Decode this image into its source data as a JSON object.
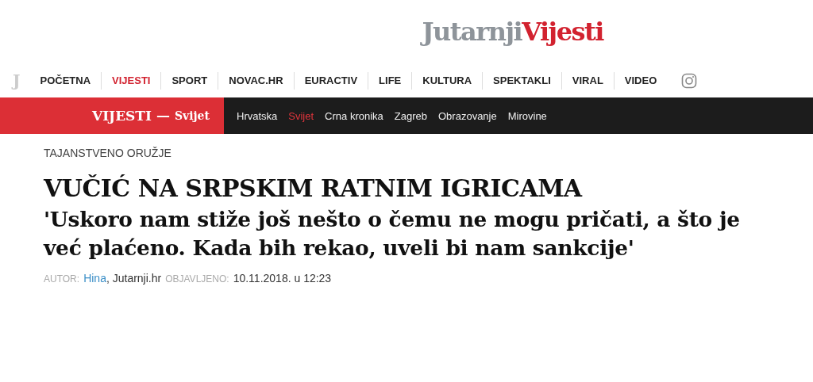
{
  "logo": {
    "part_1": "Jutarnji",
    "part_2": "Vijesti"
  },
  "nav": {
    "mark": "J",
    "items": [
      {
        "label": "POČETNA",
        "selected": false
      },
      {
        "label": "VIJESTI",
        "selected": true
      },
      {
        "label": "SPORT",
        "selected": false
      },
      {
        "label": "NOVAC.HR",
        "selected": false
      },
      {
        "label": "EURACTIV",
        "selected": false
      },
      {
        "label": "LIFE",
        "selected": false
      },
      {
        "label": "KULTURA",
        "selected": false
      },
      {
        "label": "SPEKTAKLI",
        "selected": false
      },
      {
        "label": "VIRAL",
        "selected": false
      },
      {
        "label": "VIDEO",
        "selected": false
      }
    ]
  },
  "section": {
    "title": "VIJESTI",
    "separator": "—",
    "subtitle": "Svijet",
    "items": [
      {
        "label": "Hrvatska",
        "selected": false
      },
      {
        "label": "Svijet",
        "selected": true
      },
      {
        "label": "Crna kronika",
        "selected": false
      },
      {
        "label": "Zagreb",
        "selected": false
      },
      {
        "label": "Obrazovanje",
        "selected": false
      },
      {
        "label": "Mirovine",
        "selected": false
      }
    ]
  },
  "article": {
    "kicker": "TAJANSTVENO ORUŽJE",
    "headline": "VUČIĆ NA SRPSKIM RATNIM IGRICAMA",
    "subheadline": "'Uskoro nam stiže još nešto o čemu ne mogu pričati, a što je već plaćeno. Kada bih rekao, uveli bi nam sankcije'",
    "author_label": "AUTOR:",
    "author": "Hina",
    "source": ", Jutarnji.hr",
    "published_label": "OBJAVLJENO:",
    "published": "10.11.2018. u 12:23"
  }
}
